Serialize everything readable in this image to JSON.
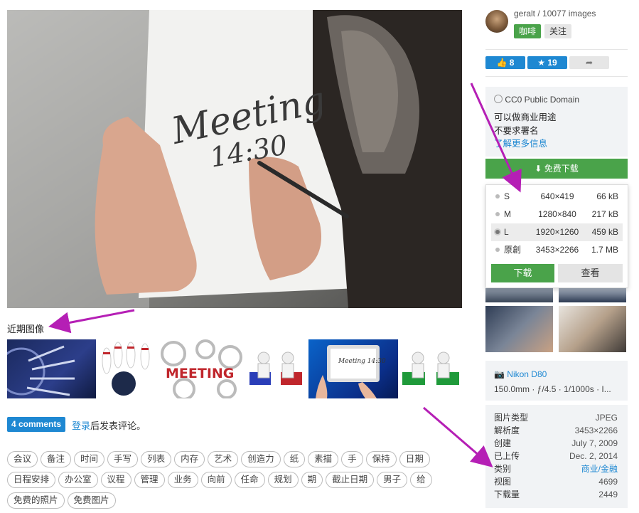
{
  "main_photo": {
    "note_line1": "Meeting",
    "note_line2": "14:30"
  },
  "recent": {
    "label": "近期图像",
    "thumbs": [
      {
        "name": "darts-target-thumb"
      },
      {
        "name": "bowling-thumb"
      },
      {
        "name": "meeting-gears-thumb",
        "text": "MEETING"
      },
      {
        "name": "figures-sofa-thumb"
      },
      {
        "name": "tablet-meeting-thumb",
        "text": "Meeting 14:30"
      },
      {
        "name": "figures-green-sofa-thumb"
      }
    ]
  },
  "comments": {
    "button": "4 comments",
    "login_link": "登录",
    "login_rest": "后发表评论。"
  },
  "tags": [
    "会议",
    "备注",
    "时间",
    "手写",
    "列表",
    "内存",
    "艺术",
    "创造力",
    "纸",
    "素描",
    "手",
    "保持",
    "日期",
    "日程安排",
    "办公室",
    "议程",
    "管理",
    "业务",
    "向前",
    "任命",
    "规划",
    "期",
    "截止日期",
    "男子",
    "给",
    "免费的照片",
    "免费图片"
  ],
  "user": {
    "name": "geralt",
    "separator": " / ",
    "count": "10077 images",
    "follow_green": "咖啡",
    "follow_gray": "关注"
  },
  "stats": {
    "likes": "8",
    "favorites": "19",
    "like_icon": "thumbs-up-icon",
    "fav_icon": "star-icon",
    "share_icon": "share-arrow-icon"
  },
  "license": {
    "title": "CC0 Public Domain",
    "line1": "可以做商业用途",
    "line2": "不要求署名",
    "more": "了解更多信息"
  },
  "download": {
    "bar_label": "免费下载",
    "sizes": [
      {
        "code": "S",
        "res": "640×419",
        "bytes": "66 kB",
        "selected": false
      },
      {
        "code": "M",
        "res": "1280×840",
        "bytes": "217 kB",
        "selected": false
      },
      {
        "code": "L",
        "res": "1920×1260",
        "bytes": "459 kB",
        "selected": true
      },
      {
        "code": "原創",
        "res": "3453×2266",
        "bytes": "1.7 MB",
        "selected": false
      }
    ],
    "download_button": "下载",
    "view_button": "查看"
  },
  "camera": {
    "model": "Nikon D80",
    "settings": "150.0mm · ƒ/4.5 · 1/1000s · I..."
  },
  "meta": [
    {
      "label": "图片类型",
      "value": "JPEG"
    },
    {
      "label": "解析度",
      "value": "3453×2266"
    },
    {
      "label": "创建",
      "value": "July 7, 2009"
    },
    {
      "label": "已上传",
      "value": "Dec. 2, 2014"
    },
    {
      "label": "类别",
      "value": "商业/金融",
      "link": true
    },
    {
      "label": "视图",
      "value": "4699"
    },
    {
      "label": "下载量",
      "value": "2449"
    }
  ],
  "colors": {
    "accent_blue": "#1e88d2",
    "green": "#4aa34a",
    "annotation_arrow": "#b51fb5"
  }
}
